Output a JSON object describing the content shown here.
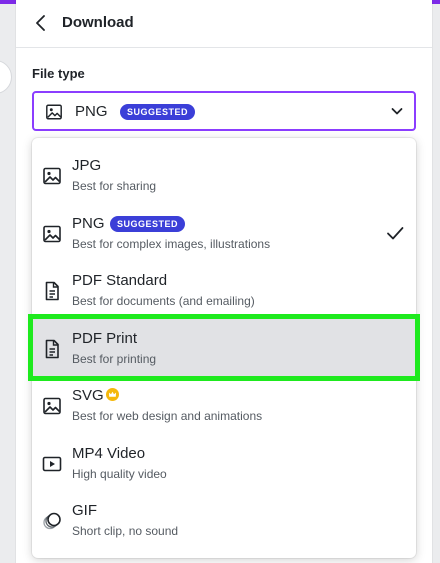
{
  "header": {
    "title": "Download"
  },
  "file_type": {
    "label": "File type",
    "selected_value": "PNG",
    "selected_badge": "SUGGESTED"
  },
  "options": [
    {
      "name": "JPG",
      "desc": "Best for sharing",
      "icon": "image-icon"
    },
    {
      "name": "PNG",
      "desc": "Best for complex images, illustrations",
      "icon": "image-icon",
      "badge": "SUGGESTED",
      "checked": true
    },
    {
      "name": "PDF Standard",
      "desc": "Best for documents (and emailing)",
      "icon": "document-icon"
    },
    {
      "name": "PDF Print",
      "desc": "Best for printing",
      "icon": "document-icon",
      "highlighted": true
    },
    {
      "name": "SVG",
      "desc": "Best for web design and animations",
      "icon": "image-icon",
      "premium": true
    },
    {
      "name": "MP4 Video",
      "desc": "High quality video",
      "icon": "video-icon"
    },
    {
      "name": "GIF",
      "desc": "Short clip, no sound",
      "icon": "gif-icon"
    }
  ],
  "colors": {
    "accent": "#8b3dff",
    "badge": "#3b3fd8",
    "highlight_frame": "#1eea1e",
    "premium_crown": "#f5b80c"
  }
}
